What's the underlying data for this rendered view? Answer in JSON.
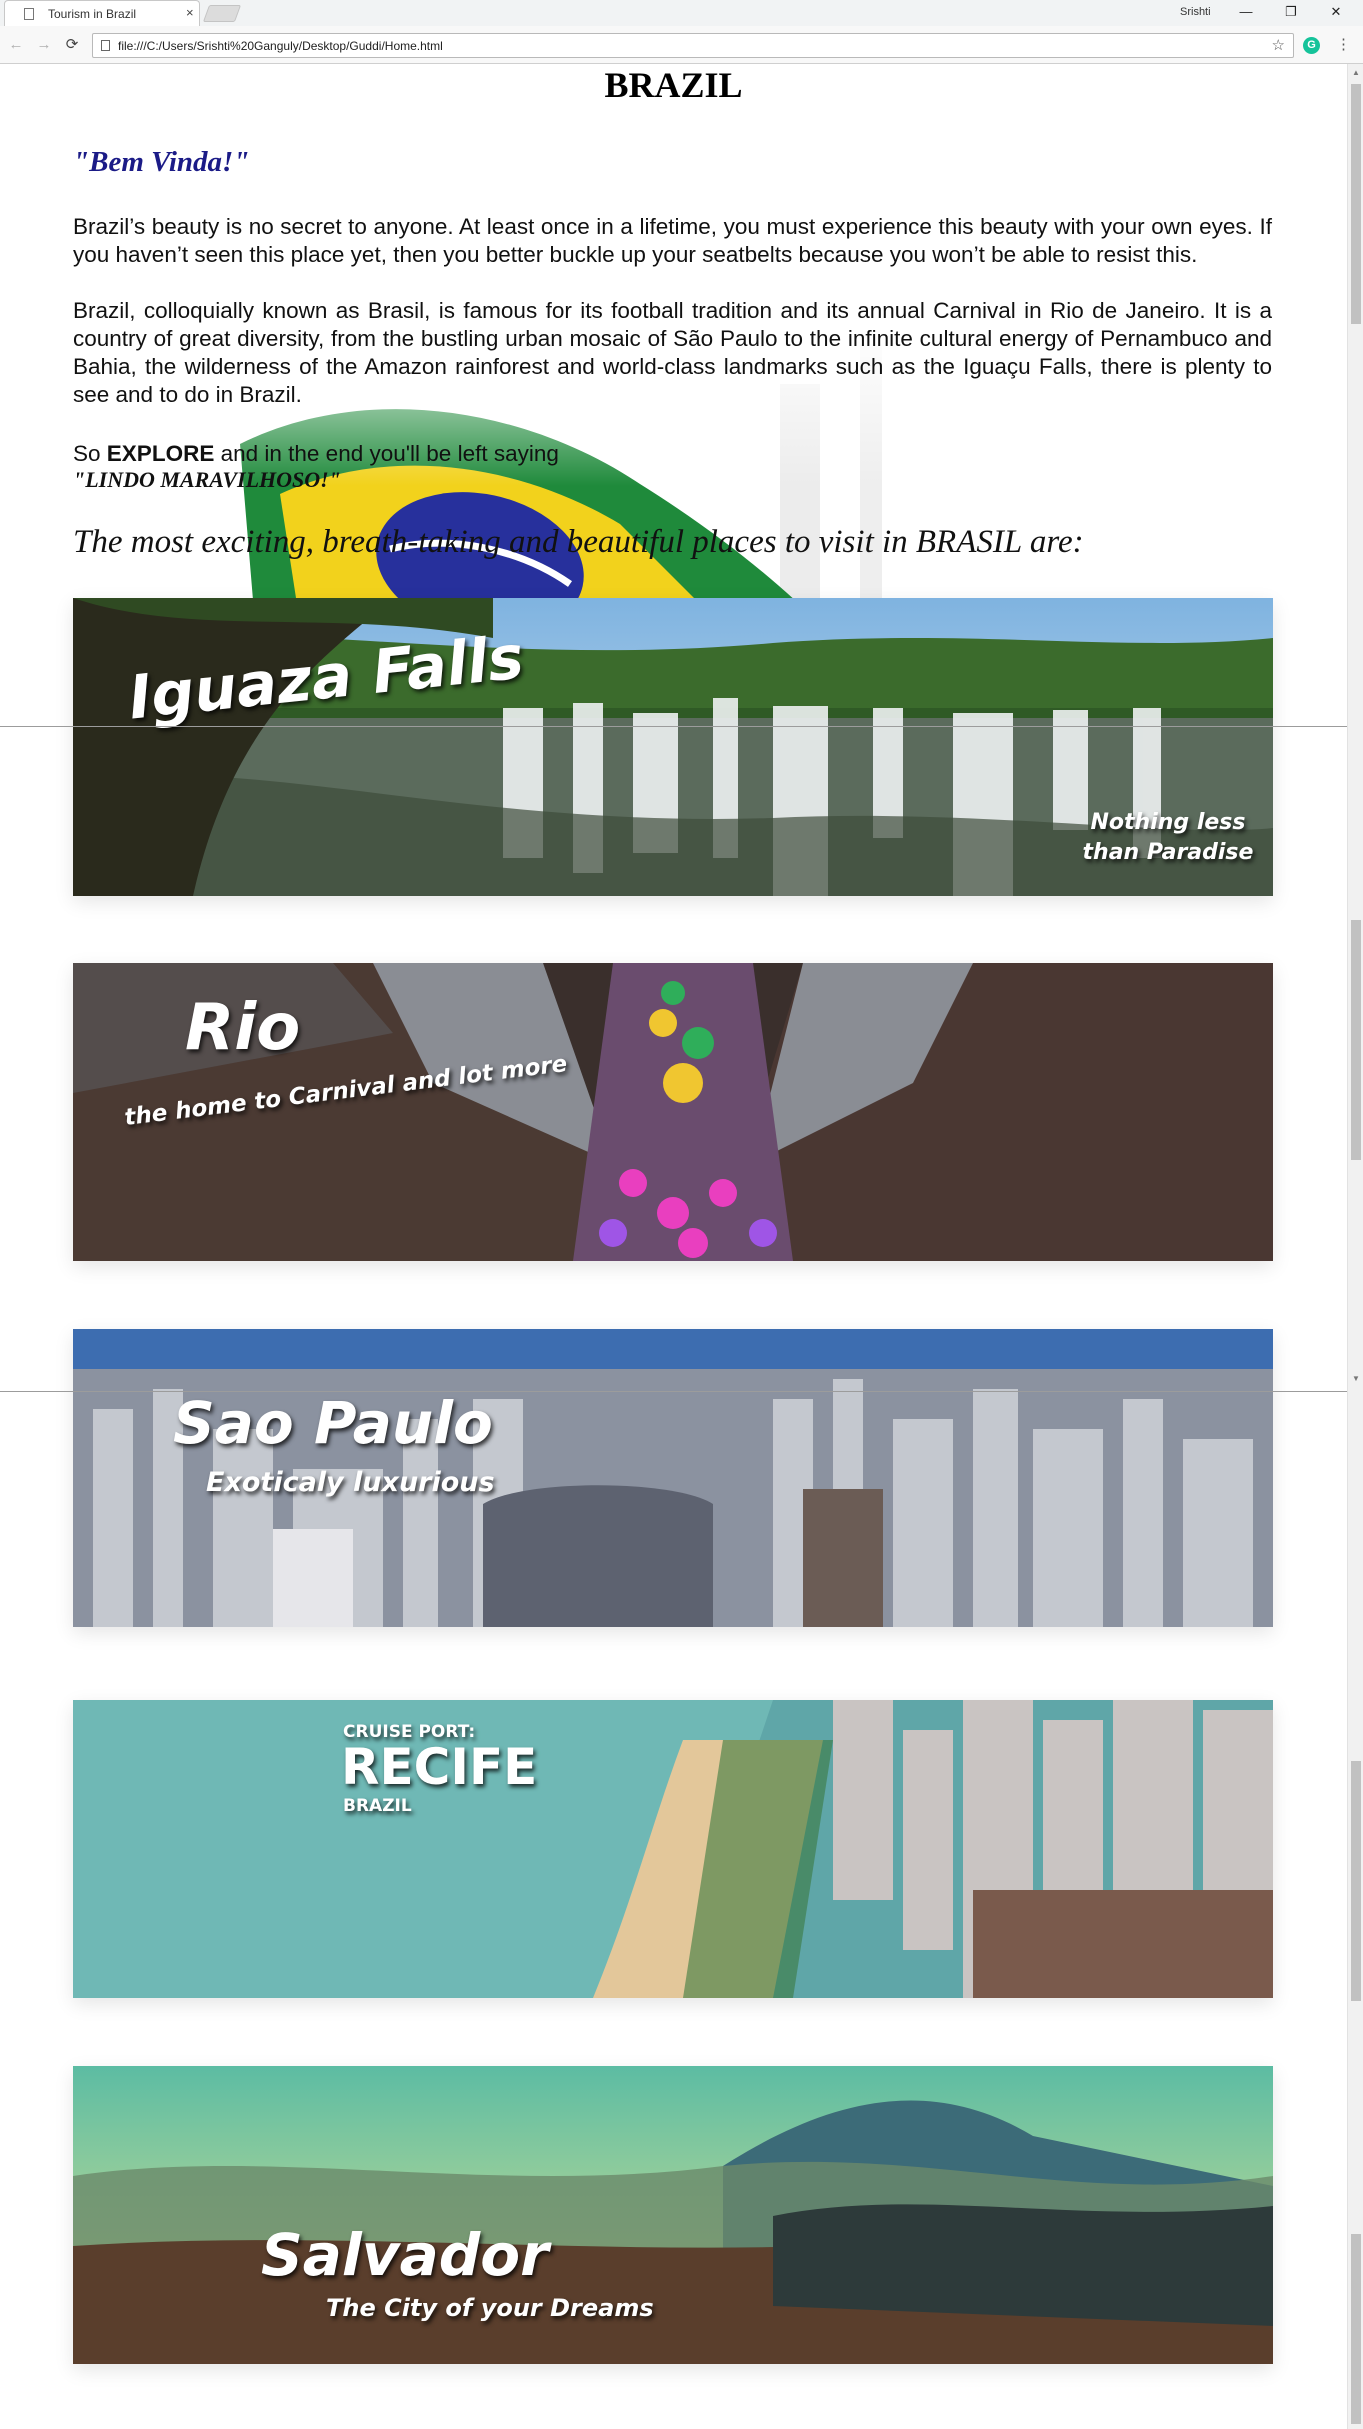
{
  "browser": {
    "tab_title": "Tourism in Brazil",
    "tab_close": "×",
    "profile_name": "Srishti",
    "url": "file:///C:/Users/Srishti%20Ganguly/Desktop/Guddi/Home.html",
    "window_controls": [
      "—",
      "❐",
      "✕"
    ],
    "nav": {
      "back": "←",
      "forward": "→",
      "reload": "⟳"
    },
    "star": "☆",
    "extension": "G",
    "menu": "⋮"
  },
  "page": {
    "title": "BRAZIL",
    "greeting": "\"Bem Vinda!\"",
    "para1": "Brazil’s beauty is no secret to anyone. At least once in a lifetime, you must experience this beauty with your own eyes. If you haven’t seen this place yet, then you better buckle up your seatbelts because you won’t be able to resist this.",
    "para2": "Brazil, colloquially known as Brasil, is famous for its football tradition and its annual Carnival in Rio de Janeiro. It is a country of great diversity, from the bustling urban mosaic of São Paulo to the infinite cultural energy of Pernambuco and Bahia, the wilderness of the Amazon rainforest and world-class landmarks such as the Iguaçu Falls, there is plenty to see and to do in Brazil.",
    "explore_prefix": "So",
    "explore_word": "EXPLORE",
    "explore_suffix": "and in the end you'll be left saying",
    "lindo": "\"LINDO MARAVILHOSO!\"",
    "places_heading": "The most exciting, breath-taking and beautiful places to visit in BRASIL are:"
  },
  "banners": {
    "iguazu": {
      "title": "Iguaza Falls",
      "tagline": "Nothing less than Paradise"
    },
    "rio": {
      "title": "Rio",
      "tagline": "the home to Carnival and lot more"
    },
    "saopaulo": {
      "title": "Sao Paulo",
      "tagline": "Exoticaly luxurious"
    },
    "recife": {
      "kicker": "CRUISE PORT:",
      "title": "RECIFE",
      "country": "BRAZIL"
    },
    "salvador": {
      "title": "Salvador",
      "tagline": "The City of your Dreams"
    }
  },
  "colors": {
    "greeting": "#1b1b87",
    "text": "#111111"
  }
}
